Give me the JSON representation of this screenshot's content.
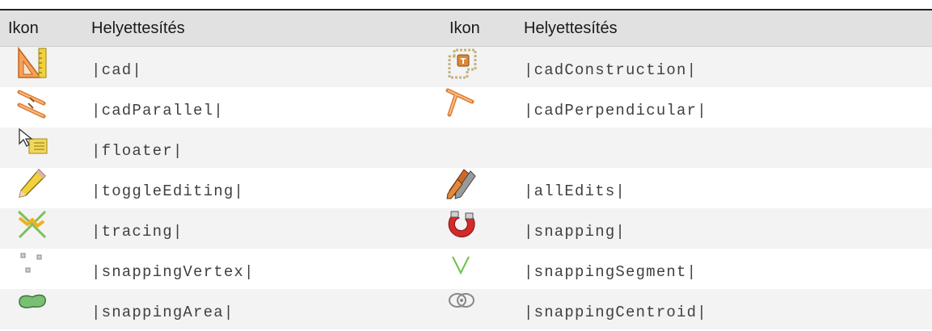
{
  "header": {
    "col1": "Ikon",
    "col2": "Helyettesítés",
    "col3": "Ikon",
    "col4": "Helyettesítés"
  },
  "rows": [
    {
      "left_icon": "cad-icon",
      "left_text": "|cad|",
      "right_icon": "cad-construction-icon",
      "right_text": "|cadConstruction|"
    },
    {
      "left_icon": "cad-parallel-icon",
      "left_text": "|cadParallel|",
      "right_icon": "cad-perpendicular-icon",
      "right_text": "|cadPerpendicular|"
    },
    {
      "left_icon": "floater-icon",
      "left_text": "|floater|",
      "right_icon": "",
      "right_text": ""
    },
    {
      "left_icon": "toggle-editing-icon",
      "left_text": "|toggleEditing|",
      "right_icon": "all-edits-icon",
      "right_text": "|allEdits|"
    },
    {
      "left_icon": "tracing-icon",
      "left_text": "|tracing|",
      "right_icon": "snapping-icon",
      "right_text": "|snapping|"
    },
    {
      "left_icon": "snapping-vertex-icon",
      "left_text": "|snappingVertex|",
      "right_icon": "snapping-segment-icon",
      "right_text": "|snappingSegment|"
    },
    {
      "left_icon": "snapping-area-icon",
      "left_text": "|snappingArea|",
      "right_icon": "snapping-centroid-icon",
      "right_text": "|snappingCentroid|"
    }
  ]
}
